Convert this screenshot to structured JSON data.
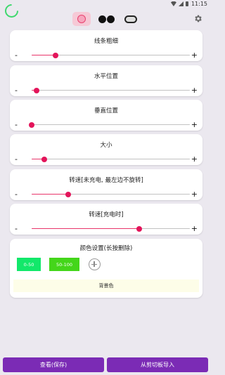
{
  "status_bar": {
    "time": "11:15"
  },
  "toolbar": {
    "modes": [
      {
        "name": "ring-mode",
        "active": true
      },
      {
        "name": "dots-mode",
        "active": false
      },
      {
        "name": "pill-mode",
        "active": false
      }
    ]
  },
  "sliders": [
    {
      "title": "线条粗细",
      "minus": "-",
      "plus": "+",
      "value_percent": 15
    },
    {
      "title": "水平位置",
      "minus": "-",
      "plus": "+",
      "value_percent": 3
    },
    {
      "title": "垂直位置",
      "minus": "-",
      "plus": "+",
      "value_percent": 0
    },
    {
      "title": "大小",
      "minus": "-",
      "plus": "+",
      "value_percent": 8
    },
    {
      "title": "转速[未充电, 最左边不旋转]",
      "minus": "-",
      "plus": "+",
      "value_percent": 23
    },
    {
      "title": "转速[充电时]",
      "minus": "-",
      "plus": "+",
      "value_percent": 68
    }
  ],
  "color_settings": {
    "title": "颜色设置(长按删除)",
    "swatches": [
      {
        "label": "0-50",
        "color": "#12e86a"
      },
      {
        "label": "50-100",
        "color": "#44d61a"
      }
    ],
    "background_label": "背景色"
  },
  "bottom_buttons": {
    "view": "查看(保存)",
    "import": "从剪切板导入"
  },
  "colors": {
    "accent": "#e3145a",
    "button": "#7b2bb5",
    "spinner": "#3fd86e"
  }
}
